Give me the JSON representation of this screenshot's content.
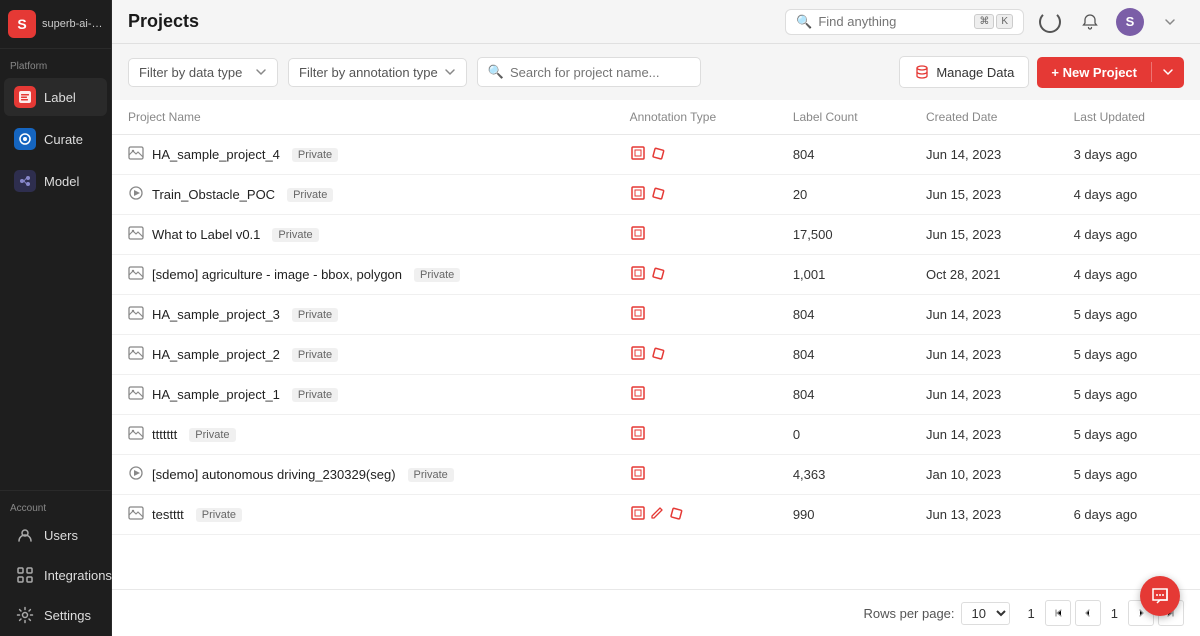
{
  "app": {
    "name": "superb-ai-dem..."
  },
  "sidebar": {
    "platform_label": "Platform",
    "items": [
      {
        "id": "label",
        "label": "Label",
        "icon": "label",
        "active": true
      },
      {
        "id": "curate",
        "label": "Curate",
        "icon": "curate",
        "active": false
      },
      {
        "id": "model",
        "label": "Model",
        "icon": "model",
        "active": false
      }
    ],
    "account_label": "Account",
    "account_items": [
      {
        "id": "users",
        "label": "Users"
      },
      {
        "id": "integrations",
        "label": "Integrations"
      },
      {
        "id": "settings",
        "label": "Settings"
      }
    ]
  },
  "header": {
    "title": "Projects",
    "search_placeholder": "Find anything",
    "shortcut1": "⌘",
    "shortcut2": "K"
  },
  "toolbar": {
    "filter_data_type": "Filter by data type",
    "filter_annotation_type": "Filter by annotation type",
    "search_project_placeholder": "Search for project name...",
    "manage_data_label": "Manage Data",
    "new_project_label": "+ New Project"
  },
  "table": {
    "columns": [
      "Project Name",
      "Annotation Type",
      "Label Count",
      "Created Date",
      "Last Updated"
    ],
    "rows": [
      {
        "name": "HA_sample_project_4",
        "visibility": "Private",
        "type_icon": "image",
        "annotation_icons": [
          "bbox",
          "bbox_r"
        ],
        "label_count": "804",
        "created_date": "Jun 14, 2023",
        "last_updated": "3 days ago"
      },
      {
        "name": "Train_Obstacle_POC",
        "visibility": "Private",
        "type_icon": "video",
        "annotation_icons": [
          "bbox",
          "bbox_r"
        ],
        "label_count": "20",
        "created_date": "Jun 15, 2023",
        "last_updated": "4 days ago"
      },
      {
        "name": "What to Label v0.1",
        "visibility": "Private",
        "type_icon": "image",
        "annotation_icons": [
          "bbox"
        ],
        "label_count": "17,500",
        "created_date": "Jun 15, 2023",
        "last_updated": "4 days ago"
      },
      {
        "name": "[sdemo] agriculture - image - bbox, polygon",
        "visibility": "Private",
        "type_icon": "image",
        "annotation_icons": [
          "bbox",
          "bbox_r"
        ],
        "label_count": "1,001",
        "created_date": "Oct 28, 2021",
        "last_updated": "4 days ago"
      },
      {
        "name": "HA_sample_project_3",
        "visibility": "Private",
        "type_icon": "image",
        "annotation_icons": [
          "bbox"
        ],
        "label_count": "804",
        "created_date": "Jun 14, 2023",
        "last_updated": "5 days ago"
      },
      {
        "name": "HA_sample_project_2",
        "visibility": "Private",
        "type_icon": "image",
        "annotation_icons": [
          "bbox",
          "bbox_r"
        ],
        "label_count": "804",
        "created_date": "Jun 14, 2023",
        "last_updated": "5 days ago"
      },
      {
        "name": "HA_sample_project_1",
        "visibility": "Private",
        "type_icon": "image",
        "annotation_icons": [
          "bbox"
        ],
        "label_count": "804",
        "created_date": "Jun 14, 2023",
        "last_updated": "5 days ago"
      },
      {
        "name": "ttttttt",
        "visibility": "Private",
        "type_icon": "image",
        "annotation_icons": [
          "bbox"
        ],
        "label_count": "0",
        "created_date": "Jun 14, 2023",
        "last_updated": "5 days ago"
      },
      {
        "name": "[sdemo] autonomous driving_230329(seg)",
        "visibility": "Private",
        "type_icon": "video",
        "annotation_icons": [
          "bbox"
        ],
        "label_count": "4,363",
        "created_date": "Jan 10, 2023",
        "last_updated": "5 days ago"
      },
      {
        "name": "testttt",
        "visibility": "Private",
        "type_icon": "image",
        "annotation_icons": [
          "bbox",
          "edit",
          "bbox_r"
        ],
        "label_count": "990",
        "created_date": "Jun 13, 2023",
        "last_updated": "6 days ago"
      }
    ]
  },
  "pagination": {
    "rows_per_page_label": "Rows per page:",
    "rows_per_page_value": "10",
    "current_page": "1",
    "total_pages": "1"
  }
}
